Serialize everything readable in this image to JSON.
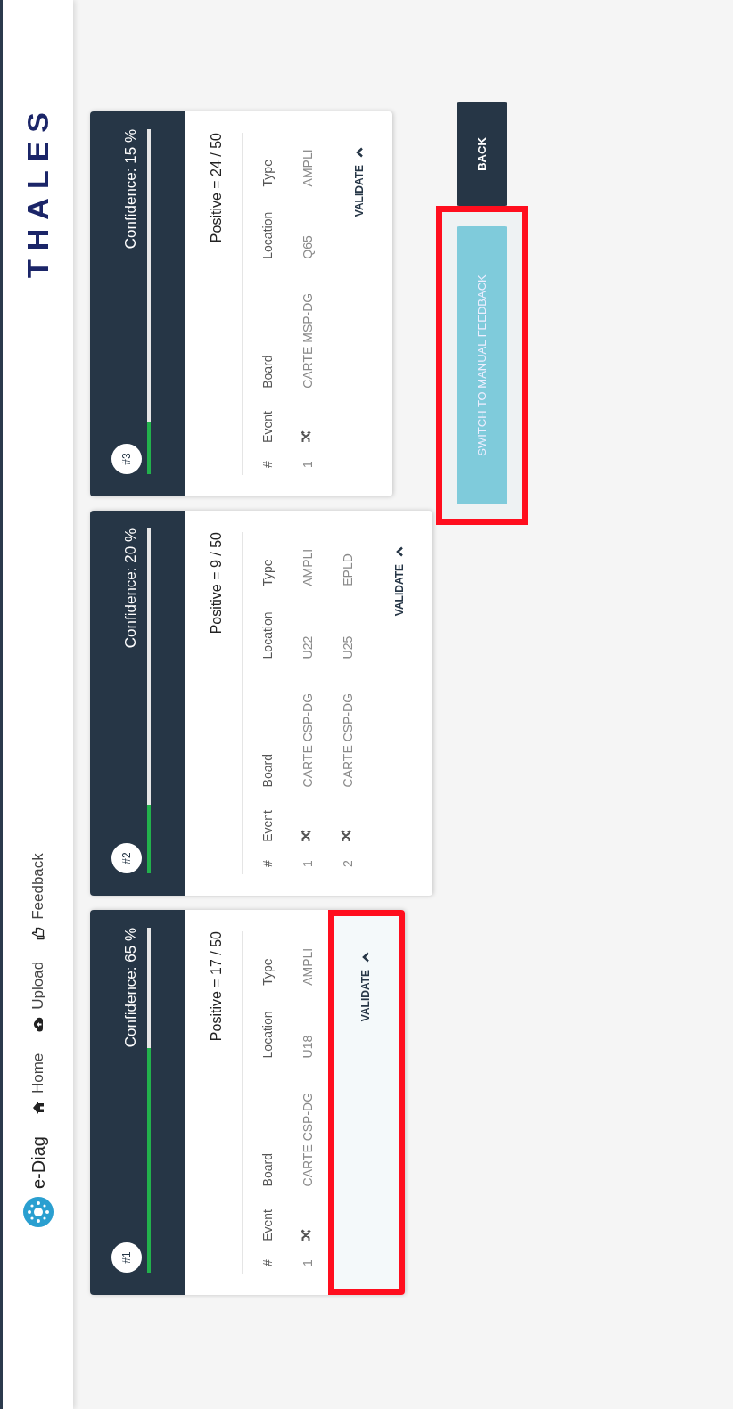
{
  "navbar": {
    "brand": "e-Diag",
    "links": [
      {
        "label": "Home"
      },
      {
        "label": "Upload"
      },
      {
        "label": "Feedback"
      }
    ],
    "logo": "THALES"
  },
  "cards": [
    {
      "badge": "#1",
      "confidence": "Confidence: 65 %",
      "level": 0.65,
      "positive": "Positive = 17 / 50",
      "columns": [
        "#",
        "Event",
        "Board",
        "Location",
        "Type"
      ],
      "rows": [
        {
          "index": "1",
          "board": "CARTE CSP-DG",
          "location": "U18",
          "type": "AMPLI"
        }
      ],
      "validate": "VALIDATE",
      "highlighted": true
    },
    {
      "badge": "#2",
      "confidence": "Confidence: 20 %",
      "level": 0.2,
      "positive": "Positive = 9 / 50",
      "columns": [
        "#",
        "Event",
        "Board",
        "Location",
        "Type"
      ],
      "rows": [
        {
          "index": "1",
          "board": "CARTE CSP-DG",
          "location": "U22",
          "type": "AMPLI"
        },
        {
          "index": "2",
          "board": "CARTE CSP-DG",
          "location": "U25",
          "type": "EPLD"
        }
      ],
      "validate": "VALIDATE",
      "highlighted": false
    },
    {
      "badge": "#3",
      "confidence": "Confidence: 15 %",
      "level": 0.15,
      "positive": "Positive = 24 / 50",
      "columns": [
        "#",
        "Event",
        "Board",
        "Location",
        "Type"
      ],
      "rows": [
        {
          "index": "1",
          "board": "CARTE MSP-DG",
          "location": "Q65",
          "type": "AMPLI"
        }
      ],
      "validate": "VALIDATE",
      "highlighted": false
    }
  ],
  "buttons": [
    {
      "label": "SWITCH TO MANUAL FEEDBACK",
      "kind": "info",
      "highlighted": true
    },
    {
      "label": "BACK",
      "kind": "dark",
      "highlighted": false
    }
  ]
}
